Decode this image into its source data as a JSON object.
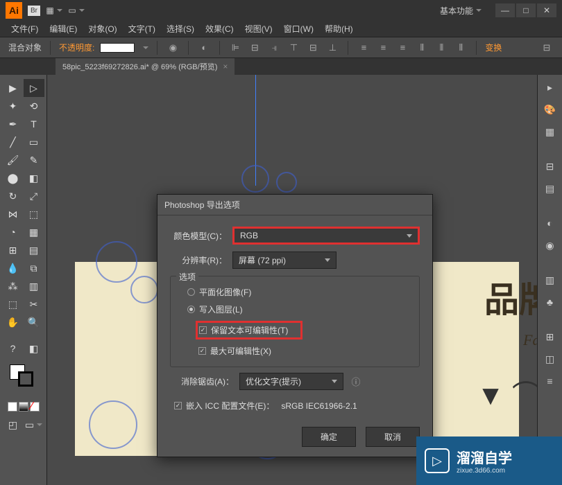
{
  "title_bar": {
    "app_badge": "Ai",
    "br_badge": "Br",
    "workspace": "基本功能"
  },
  "menu": {
    "items": [
      "文件(F)",
      "编辑(E)",
      "对象(O)",
      "文字(T)",
      "选择(S)",
      "效果(C)",
      "视图(V)",
      "窗口(W)",
      "帮助(H)"
    ]
  },
  "options": {
    "blend_label": "混合对象",
    "opacity_label": "不透明度:",
    "swap_label": "变换"
  },
  "document": {
    "tab": "58pic_5223f69272826.ai* @ 69% (RGB/预览)"
  },
  "artboard": {
    "text1": "品牌",
    "text2": "Fash"
  },
  "dialog": {
    "title": "Photoshop 导出选项",
    "color_model_label": "颜色模型(C)：",
    "color_model_value": "RGB",
    "resolution_label": "分辨率(R)：",
    "resolution_value": "屏幕 (72 ppi)",
    "options_group": "选项",
    "flat_image": "平面化图像(F)",
    "write_layers": "写入图层(L)",
    "preserve_text": "保留文本可编辑性(T)",
    "max_edit": "最大可编辑性(X)",
    "antialias_label": "消除锯齿(A)：",
    "antialias_value": "优化文字(提示)",
    "embed_icc": "嵌入 ICC 配置文件(E)：",
    "icc_profile": "sRGB IEC61966-2.1",
    "ok": "确定",
    "cancel": "取消"
  },
  "watermark": {
    "main": "溜溜自学",
    "sub": "zixue.3d66.com"
  }
}
